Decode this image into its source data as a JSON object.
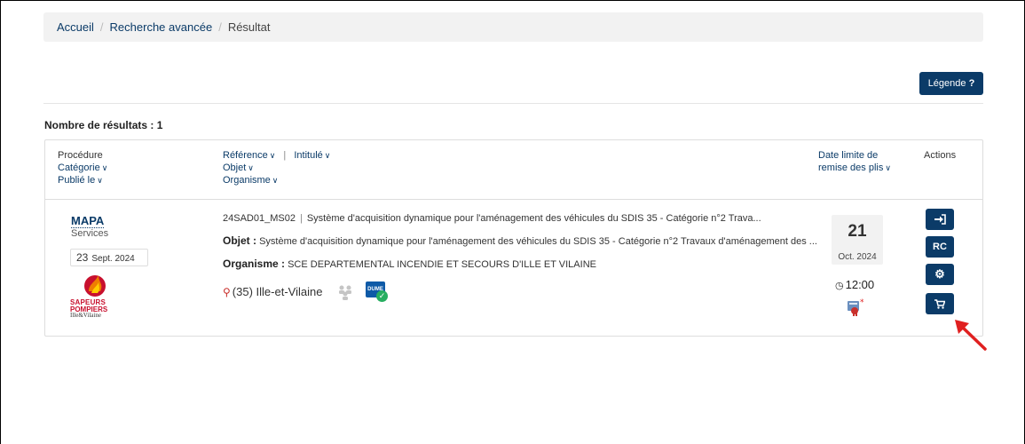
{
  "breadcrumb": {
    "home": "Accueil",
    "advanced": "Recherche avancée",
    "current": "Résultat",
    "separator": "/"
  },
  "legend_button": {
    "label": "Légende",
    "icon": "?"
  },
  "results_count": "Nombre de résultats : 1",
  "table_header": {
    "procedure": "Procédure",
    "category": "Catégorie",
    "published": "Publié le",
    "reference": "Référence",
    "title": "Intitulé",
    "object": "Objet",
    "organism": "Organisme",
    "deadline_line1": "Date limite de",
    "deadline_line2": "remise des plis",
    "actions": "Actions",
    "chevron": "∨",
    "pipe": "|"
  },
  "result": {
    "procedure": "MAPA",
    "category": "Services",
    "published_day": "23",
    "published_month": "Sept. 2024",
    "logo_line1": "SAPEURS",
    "logo_line2": "POMPIERS",
    "logo_line3": "Ille&Vilaine",
    "reference": "24SAD01_MS02",
    "title": "Système d'acquisition dynamique pour l'aménagement des véhicules du SDIS 35 - Catégorie n°2 Trava...",
    "object_label": "Objet :",
    "object": "Système d'acquisition dynamique pour l'aménagement des véhicules du SDIS 35 - Catégorie n°2 Travaux d'aménagement des ...",
    "organism_label": "Organisme :",
    "organism": "SCE DEPARTEMENTAL INCENDIE ET SECOURS D'ILLE ET VILAINE",
    "location": "(35) Ille-et-Vilaine",
    "dume_label": "DUME",
    "deadline_day": "21",
    "deadline_month": "Oct.  2024",
    "deadline_time": "12:00",
    "actions": {
      "participate_icon": "sign-in-icon",
      "rc_label": "RC",
      "settings_icon": "gear-icon",
      "cart_icon": "cart-icon"
    }
  },
  "colors": {
    "primary": "#0b3b68",
    "arrow": "#e02020",
    "breadcrumb_bg": "#f2f2f2"
  }
}
